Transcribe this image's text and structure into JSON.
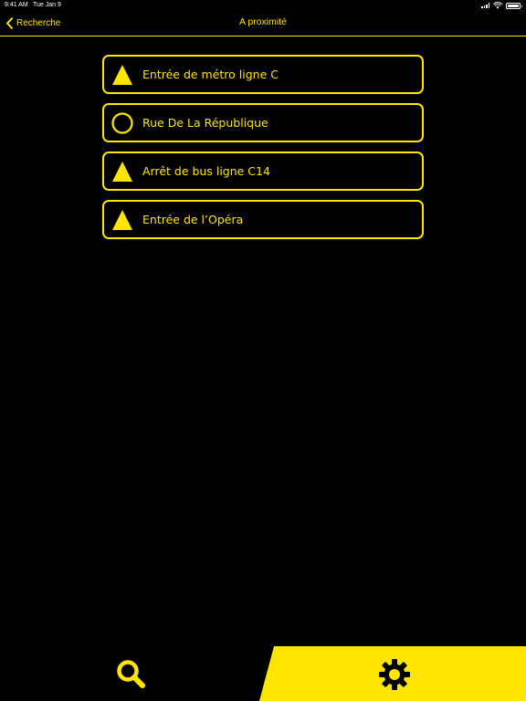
{
  "status_bar": {
    "time": "9:41 AM",
    "date": "Tue Jan 9",
    "icons": [
      "signal-icon",
      "wifi-icon",
      "battery-icon"
    ],
    "battery_level": 1.0
  },
  "nav": {
    "back_label": "Recherche",
    "title": "A proximité"
  },
  "places": [
    {
      "label": "Entrée de métro ligne C",
      "icon": "triangle-icon"
    },
    {
      "label": "Rue De La République",
      "icon": "circle-icon"
    },
    {
      "label": "Arrêt de bus ligne C14",
      "icon": "triangle-icon"
    },
    {
      "label": "Entrée de l’Opéra",
      "icon": "triangle-icon"
    }
  ],
  "tab_bar": {
    "tabs": [
      {
        "name": "search",
        "icon": "search-icon",
        "selected": false
      },
      {
        "name": "settings",
        "icon": "gear-icon",
        "selected": true
      }
    ]
  },
  "colors": {
    "accent": "#ffe600",
    "background": "#000000",
    "status_text": "#ffffff"
  }
}
